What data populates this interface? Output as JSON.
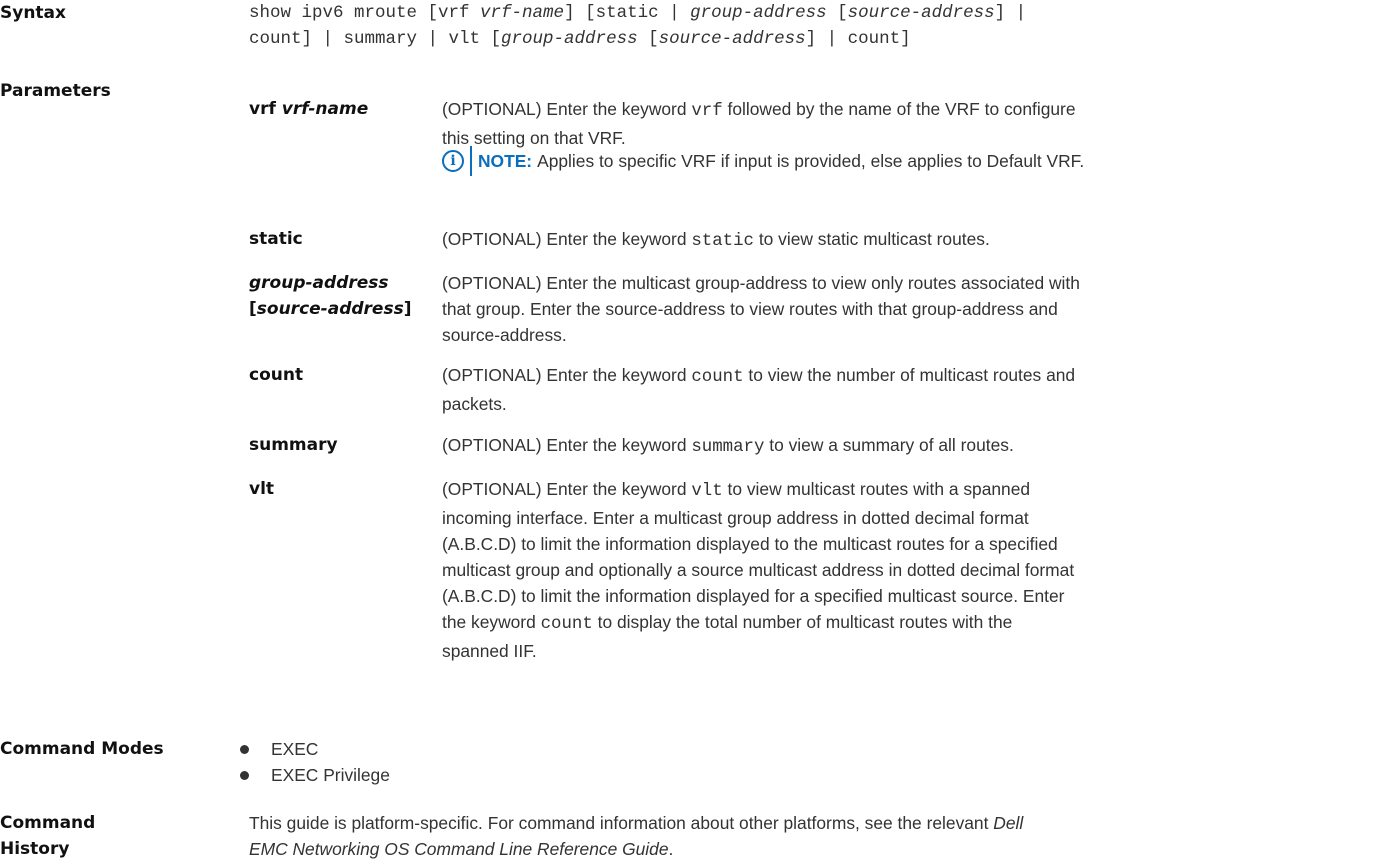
{
  "labels": {
    "syntax": "Syntax",
    "parameters": "Parameters",
    "command_modes": "Command Modes",
    "command_history_1": "Command",
    "command_history_2": "History"
  },
  "syntax": {
    "line1_a": "show ipv6 mroute [vrf ",
    "line1_b": "vrf-name",
    "line1_c": "] [static | ",
    "line1_d": "group-address",
    "line1_e": " [",
    "line1_f": "source-address",
    "line1_g": "] |",
    "line2_a": "count] | summary | vlt [",
    "line2_b": "group-address",
    "line2_c": " [",
    "line2_d": "source-address",
    "line2_e": "] | count]"
  },
  "params": [
    {
      "term_a": "vrf ",
      "term_b": "vrf-name",
      "desc_1a": "(OPTIONAL) Enter the keyword ",
      "desc_1kw": "vrf",
      "desc_1b": " followed by the name of the VRF to configure",
      "desc_2": "this setting on that VRF."
    },
    {
      "term": "static",
      "desc_a": "(OPTIONAL) Enter the keyword ",
      "desc_kw": "static",
      "desc_b": " to view static multicast routes."
    },
    {
      "term_a": "group-address",
      "term_b1": "[",
      "term_b2": "source-address",
      "term_b3": "]",
      "desc_1": "(OPTIONAL) Enter the multicast group-address to view only routes associated with",
      "desc_2": "that group. Enter the source-address to view routes with that group-address and",
      "desc_3": "source-address."
    },
    {
      "term": "count",
      "desc_1a": "(OPTIONAL) Enter the keyword ",
      "desc_1kw": "count",
      "desc_1b": " to view the number of multicast routes and",
      "desc_2": "packets."
    },
    {
      "term": "summary",
      "desc_a": "(OPTIONAL) Enter the keyword ",
      "desc_kw": "summary",
      "desc_b": " to view a summary of all routes."
    },
    {
      "term": "vlt",
      "desc_1a": "(OPTIONAL) Enter the keyword ",
      "desc_1kw": "vlt",
      "desc_1b": " to view multicast routes with a spanned",
      "desc_2": "incoming interface. Enter a multicast group address in dotted decimal format",
      "desc_3": "(A.B.C.D) to limit the information displayed to the multicast routes for a specified",
      "desc_4": "multicast group and optionally a source multicast address in dotted decimal format",
      "desc_5": "(A.B.C.D) to limit the information displayed for a specified multicast source. Enter",
      "desc_6a": "the keyword ",
      "desc_6kw": "count",
      "desc_6b": " to display the total number of multicast routes with the",
      "desc_7": "spanned IIF."
    }
  ],
  "note": {
    "icon": "info-icon",
    "label": "NOTE:",
    "text": "Applies to specific VRF if input is provided, else applies to Default VRF."
  },
  "modes": [
    "EXEC",
    "EXEC Privilege"
  ],
  "history": {
    "line1_a": "This guide is platform-specific. For command information about other platforms, see the relevant ",
    "line1_b": "Dell",
    "line2_a": "EMC Networking OS Command Line Reference Guide",
    "line2_b": "."
  },
  "colors": {
    "note_accent": "#0a6ebd",
    "text": "#333333"
  }
}
